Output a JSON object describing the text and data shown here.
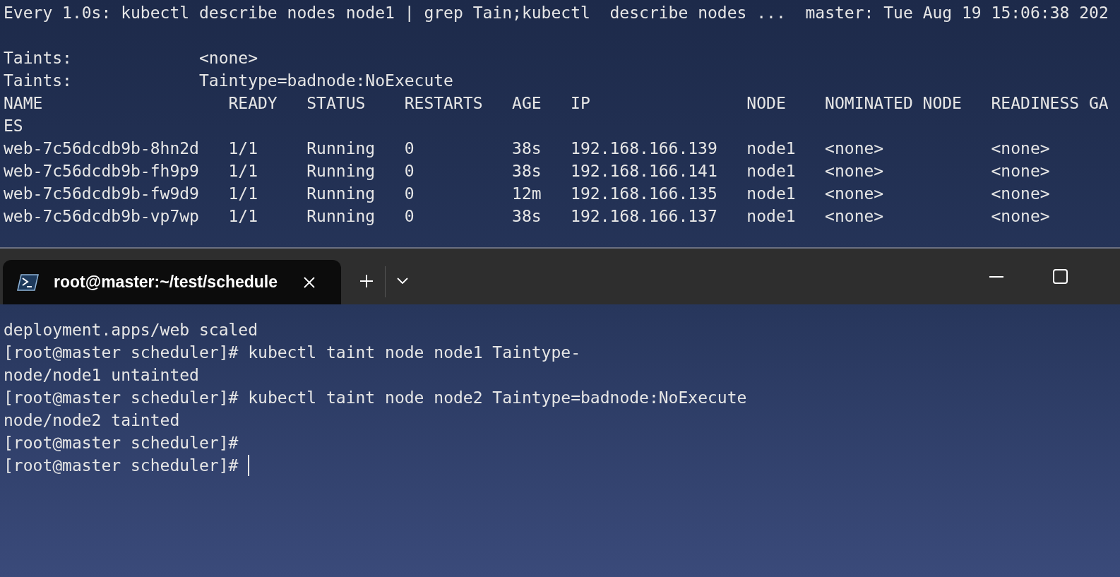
{
  "watch_pane": {
    "header": "Every 1.0s: kubectl describe nodes node1 | grep Tain;kubectl  describe nodes ...  master: Tue Aug 19 15:06:38 202",
    "taints": [
      {
        "label": "Taints:",
        "value": "<none>"
      },
      {
        "label": "Taints:",
        "value": "Taintype=badnode:NoExecute"
      }
    ],
    "table": {
      "columns": [
        "NAME",
        "READY",
        "STATUS",
        "RESTARTS",
        "AGE",
        "IP",
        "NODE",
        "NOMINATED NODE",
        "READINESS GA"
      ],
      "wrapped_header": "ES",
      "rows": [
        [
          "web-7c56dcdb9b-8hn2d",
          "1/1",
          "Running",
          "0",
          "38s",
          "192.168.166.139",
          "node1",
          "<none>",
          "<none>"
        ],
        [
          "web-7c56dcdb9b-fh9p9",
          "1/1",
          "Running",
          "0",
          "38s",
          "192.168.166.141",
          "node1",
          "<none>",
          "<none>"
        ],
        [
          "web-7c56dcdb9b-fw9d9",
          "1/1",
          "Running",
          "0",
          "12m",
          "192.168.166.135",
          "node1",
          "<none>",
          "<none>"
        ],
        [
          "web-7c56dcdb9b-vp7wp",
          "1/1",
          "Running",
          "0",
          "38s",
          "192.168.166.137",
          "node1",
          "<none>",
          "<none>"
        ]
      ]
    }
  },
  "tabs": [
    {
      "title": "root@master:~/test/schedule",
      "selected": true
    }
  ],
  "terminal": {
    "lines": [
      {
        "kind": "output",
        "text": "deployment.apps/web scaled"
      },
      {
        "kind": "command",
        "prompt": "[root@master scheduler]#",
        "text": "kubectl taint node node1 Taintype-"
      },
      {
        "kind": "output",
        "text": "node/node1 untainted"
      },
      {
        "kind": "command",
        "prompt": "[root@master scheduler]#",
        "text": "kubectl taint node node2 Taintype=badnode:NoExecute"
      },
      {
        "kind": "output",
        "text": "node/node2 tainted"
      },
      {
        "kind": "command",
        "prompt": "[root@master scheduler]#"
      },
      {
        "kind": "command",
        "prompt": "[root@master scheduler]#",
        "cursor": true
      }
    ]
  }
}
